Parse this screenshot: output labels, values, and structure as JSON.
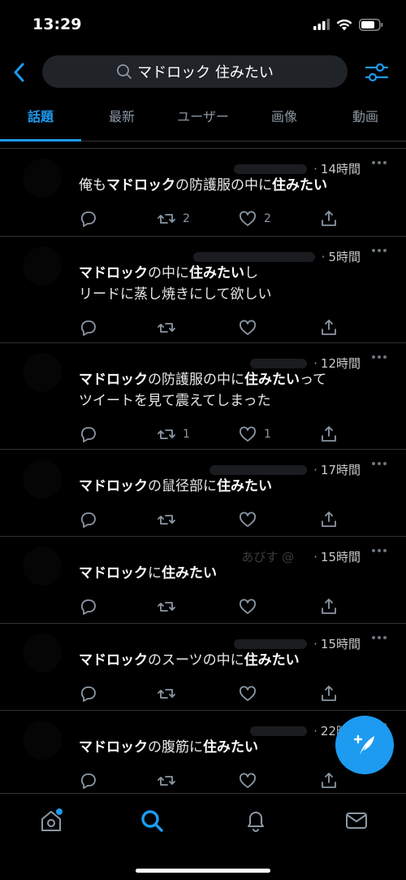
{
  "status_bar": {
    "time": "13:29"
  },
  "search": {
    "query": "マドロック 住みたい"
  },
  "tabs": [
    {
      "label": "話題"
    },
    {
      "label": "最新"
    },
    {
      "label": "ユーザー"
    },
    {
      "label": "画像"
    },
    {
      "label": "動画"
    }
  ],
  "tweets": [
    {
      "time": "14時間",
      "lines": [
        [
          "俺も",
          "b:マドロック",
          "の防護服の中に",
          "b:住みたい"
        ]
      ],
      "retweets": "2",
      "likes": "2"
    },
    {
      "time": "5時間",
      "lines": [
        [
          "b:マドロック",
          "の中に",
          "b:住みたい",
          "し"
        ],
        [
          "リードに蒸し焼きにして欲しい"
        ]
      ],
      "retweets": "",
      "likes": ""
    },
    {
      "time": "12時間",
      "lines": [
        [
          "b:マドロック",
          "の防護服の中に",
          "b:住みたい",
          "って"
        ],
        [
          "ツイートを見て震えてしまった"
        ]
      ],
      "retweets": "1",
      "likes": "1"
    },
    {
      "time": "17時間",
      "lines": [
        [
          "b:マドロック",
          "の鼠径部に",
          "b:住みたい"
        ]
      ],
      "retweets": "",
      "likes": ""
    },
    {
      "time": "15時間",
      "name_prefix": "あびす @",
      "lines": [
        [
          "b:マドロック",
          "に",
          "b:住みたい"
        ]
      ],
      "retweets": "",
      "likes": ""
    },
    {
      "time": "15時間",
      "lines": [
        [
          "b:マドロック",
          "のスーツの中に",
          "b:住みたい"
        ]
      ],
      "retweets": "",
      "likes": ""
    },
    {
      "time": "22時間",
      "lines": [
        [
          "b:マドロック",
          "の腹筋に",
          "b:住みたい"
        ]
      ],
      "retweets": "",
      "likes": ""
    }
  ],
  "colors": {
    "accent": "#1d9bf0",
    "background": "#000000",
    "muted": "#8b98a5"
  },
  "icons": {
    "nav": [
      "home-icon",
      "search-icon",
      "notifications-icon",
      "messages-icon"
    ],
    "compose": "compose-tweet-icon"
  }
}
